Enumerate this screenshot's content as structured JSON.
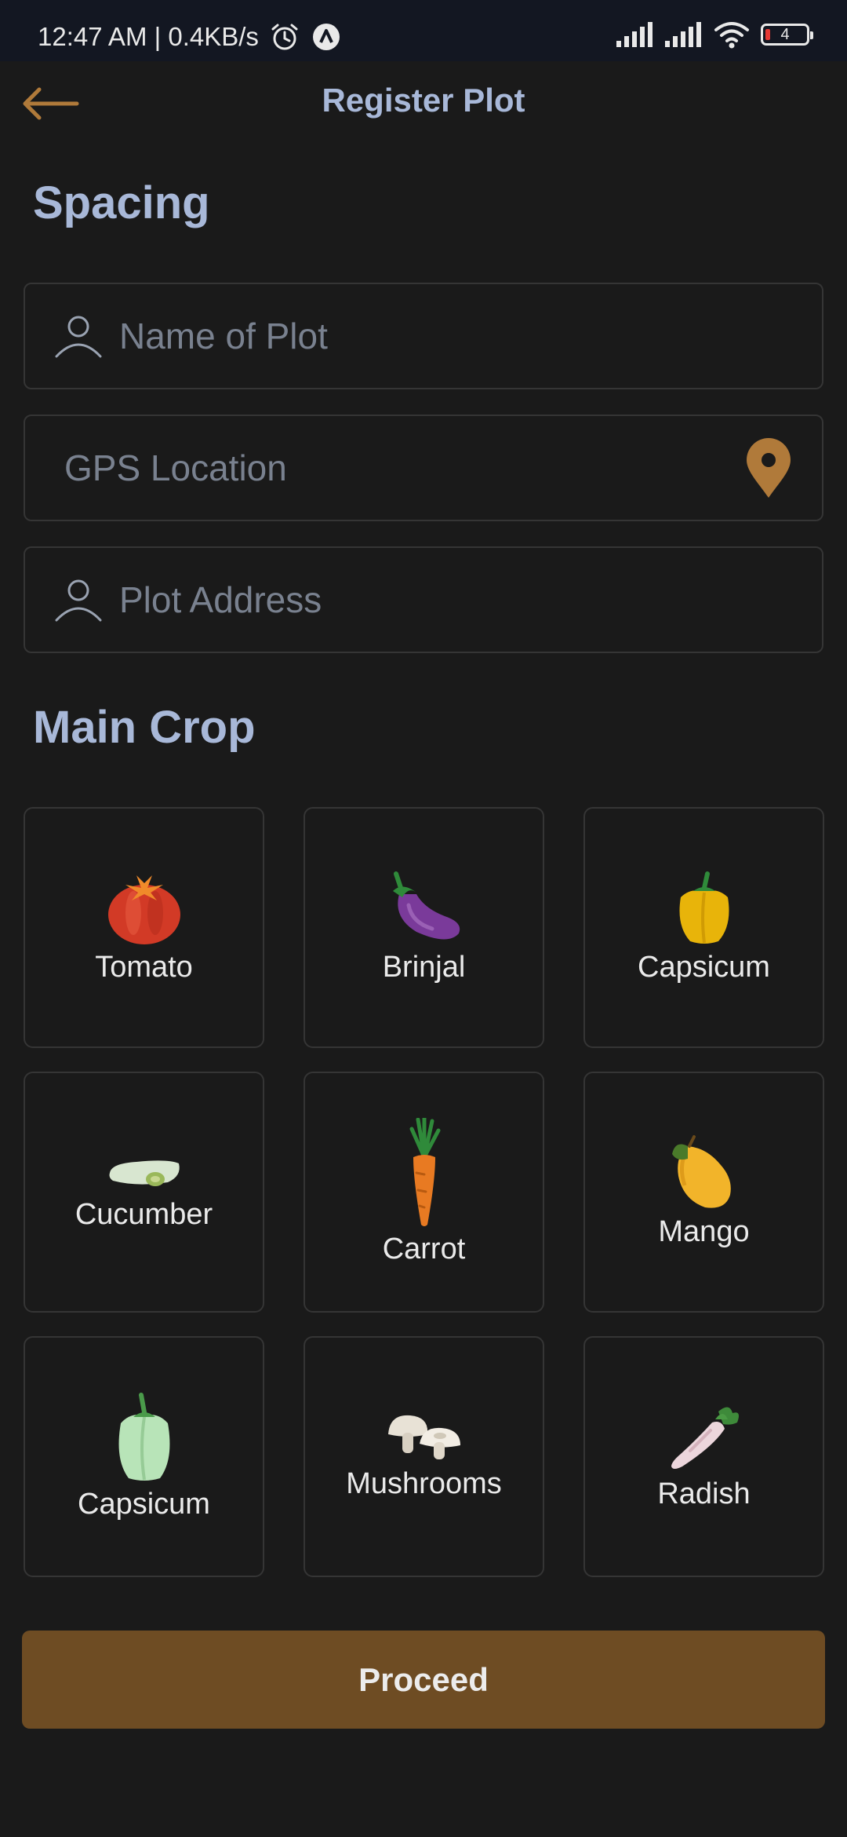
{
  "status_bar": {
    "time": "12:47 AM | 0.4KB/s",
    "battery_level": "4",
    "icons": [
      "alarm-icon",
      "app-notification-icon",
      "signal-icon",
      "signal-icon",
      "wifi-icon",
      "battery-icon"
    ]
  },
  "header": {
    "title": "Register Plot",
    "back_icon": "arrow-left-icon"
  },
  "spacing_section": {
    "title": "Spacing"
  },
  "form": {
    "plot_name": {
      "placeholder": "Name of Plot",
      "value": "",
      "icon": "person-icon"
    },
    "gps_location": {
      "placeholder": "GPS Location",
      "value": "",
      "icon": "location-pin-icon"
    },
    "plot_address": {
      "placeholder": "Plot Address",
      "value": "",
      "icon": "person-icon"
    }
  },
  "main_crop": {
    "title": "Main Crop",
    "crops": [
      {
        "label": "Tomato",
        "icon": "tomato-icon"
      },
      {
        "label": "Brinjal",
        "icon": "brinjal-icon"
      },
      {
        "label": "Capsicum",
        "icon": "yellow-capsicum-icon"
      },
      {
        "label": "Cucumber",
        "icon": "cucumber-icon"
      },
      {
        "label": "Carrot",
        "icon": "carrot-icon"
      },
      {
        "label": "Mango",
        "icon": "mango-icon"
      },
      {
        "label": "Capsicum",
        "icon": "green-capsicum-icon"
      },
      {
        "label": "Mushrooms",
        "icon": "mushrooms-icon"
      },
      {
        "label": "Radish",
        "icon": "radish-icon"
      }
    ]
  },
  "actions": {
    "proceed_label": "Proceed"
  },
  "colors": {
    "background": "#1a1a1a",
    "status_bar": "#131722",
    "heading": "#a8b8d8",
    "accent": "#b07a3a",
    "button": "#6e4c23",
    "border": "#353535",
    "placeholder": "#79818f"
  }
}
